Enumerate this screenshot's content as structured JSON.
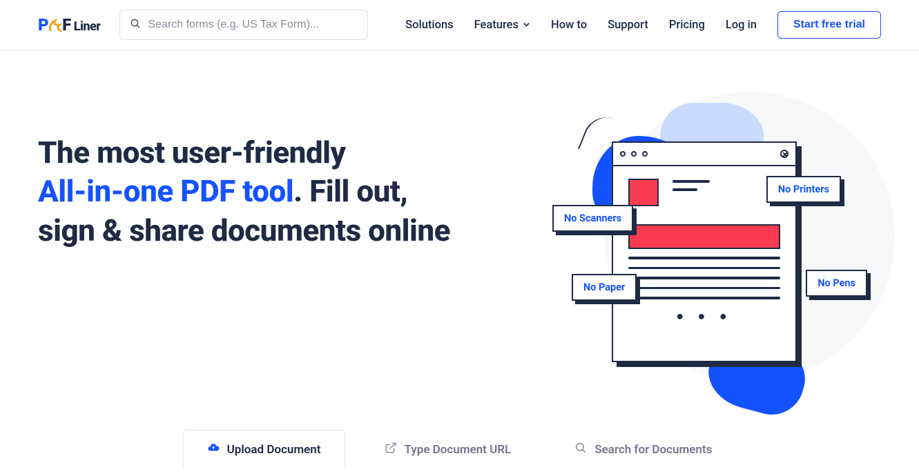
{
  "logo": {
    "p": "P",
    "f": "F",
    "liner": "Liner"
  },
  "search": {
    "placeholder": "Search forms (e.g. US Tax Form)..."
  },
  "nav": {
    "solutions": "Solutions",
    "features": "Features",
    "howto": "How to",
    "support": "Support",
    "pricing": "Pricing",
    "login": "Log in",
    "trial": "Start free trial"
  },
  "hero": {
    "line1": "The most user-friendly",
    "highlight": "All-in-one PDF tool",
    "line2a": ". Fill out,",
    "line3": "sign & share documents online",
    "labels": {
      "scanners": "No Scanners",
      "printers": "No Printers",
      "paper": "No Paper",
      "pens": "No Pens"
    },
    "dots": "● ● ●"
  },
  "tabs": {
    "upload": "Upload Document",
    "url": "Type Document URL",
    "search": "Search for Documents"
  },
  "colors": {
    "primary": "#1552ff",
    "accent": "#fb3b4f",
    "text": "#1f2a44"
  }
}
